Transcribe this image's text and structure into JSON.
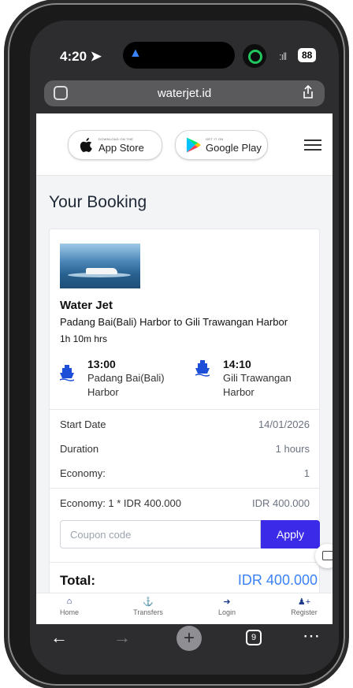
{
  "status_bar": {
    "time": "4:20",
    "battery": "88"
  },
  "browser": {
    "url": "waterjet.id",
    "tab_count": "9"
  },
  "header": {
    "app_store": {
      "small": "DOWNLOAD ON THE",
      "label": "App Store"
    },
    "google_play": {
      "small": "GET IT ON",
      "label": "Google Play"
    }
  },
  "page_title": "Your Booking",
  "trip": {
    "title": "Water Jet",
    "route": "Padang Bai(Bali) Harbor to Gili Trawangan Harbor",
    "duration": "1h 10m hrs",
    "depart": {
      "time": "13:00",
      "port_line1": "Padang Bai(Bali)",
      "port_line2": "Harbor"
    },
    "arrive": {
      "time": "14:10",
      "port_line1": "Gili Trawangan",
      "port_line2": "Harbor"
    }
  },
  "details": [
    {
      "label": "Start Date",
      "value": "14/01/2026"
    },
    {
      "label": "Duration",
      "value": "1 hours"
    },
    {
      "label": "Economy:",
      "value": "1"
    }
  ],
  "price_line": {
    "label": "Economy: 1 * IDR 400.000",
    "value": "IDR 400.000"
  },
  "coupon": {
    "placeholder": "Coupon code",
    "apply_label": "Apply"
  },
  "total": {
    "label": "Total:",
    "value": "IDR 400.000"
  },
  "bottom_nav": [
    {
      "label": "Home",
      "icon": "home-icon"
    },
    {
      "label": "Transfers",
      "icon": "ship-icon"
    },
    {
      "label": "Login",
      "icon": "login-icon"
    },
    {
      "label": "Register",
      "icon": "user-plus-icon"
    }
  ],
  "colors": {
    "accent": "#3b2ae8",
    "total": "#3b82f6",
    "icon_blue": "#1d4ed8"
  }
}
